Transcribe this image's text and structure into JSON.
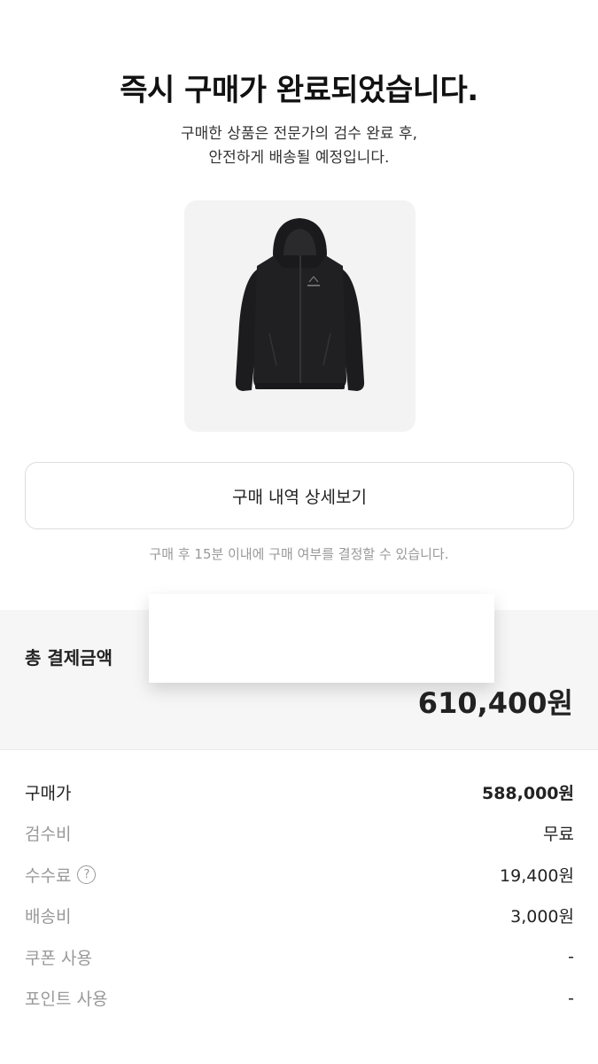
{
  "header": {
    "title": "즉시 구매가 완료되었습니다.",
    "subtitle_line1": "구매한 상품은 전문가의 검수 완료 후,",
    "subtitle_line2": "안전하게 배송될 예정입니다."
  },
  "product": {
    "image": "black-hooded-jacket"
  },
  "actions": {
    "detail_label": "구매 내역 상세보기"
  },
  "notice": "구매 후 15분 이내에 구매 여부를 결정할 수 있습니다.",
  "total": {
    "label": "총 결제금액",
    "amount": "610,400원"
  },
  "breakdown": [
    {
      "label": "구매가",
      "value": "588,000원"
    },
    {
      "label": "검수비",
      "value": "무료"
    },
    {
      "label": "수수료",
      "value": "19,400원",
      "help_icon": "?"
    },
    {
      "label": "배송비",
      "value": "3,000원"
    },
    {
      "label": "쿠폰 사용",
      "value": "-"
    },
    {
      "label": "포인트 사용",
      "value": "-"
    }
  ]
}
